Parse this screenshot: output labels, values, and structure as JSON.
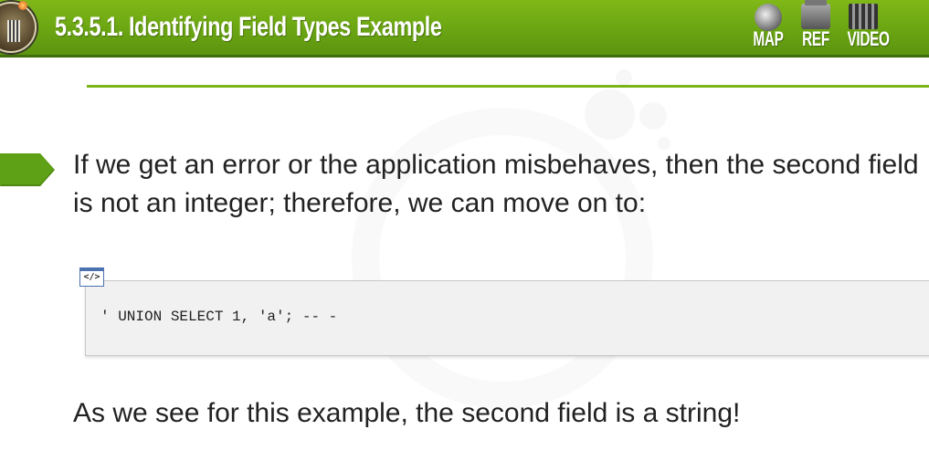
{
  "header": {
    "title": "5.3.5.1. Identifying Field Types Example",
    "nav": [
      {
        "label": "MAP",
        "icon": "globe-icon"
      },
      {
        "label": "REF",
        "icon": "filing-cabinet-icon"
      },
      {
        "label": "VIDEO",
        "icon": "film-reel-icon"
      }
    ]
  },
  "content": {
    "paragraph1": "If we get an error or the application misbehaves, then the second field is not an integer; therefore, we can move on to:",
    "code_tab": "</>",
    "code": "' UNION SELECT 1, 'a'; -- -",
    "paragraph2": "As we see for this example, the second field is a string!"
  },
  "colors": {
    "accent": "#6aa512",
    "rule": "#7cb518",
    "code_tab": "#4a72b0"
  }
}
